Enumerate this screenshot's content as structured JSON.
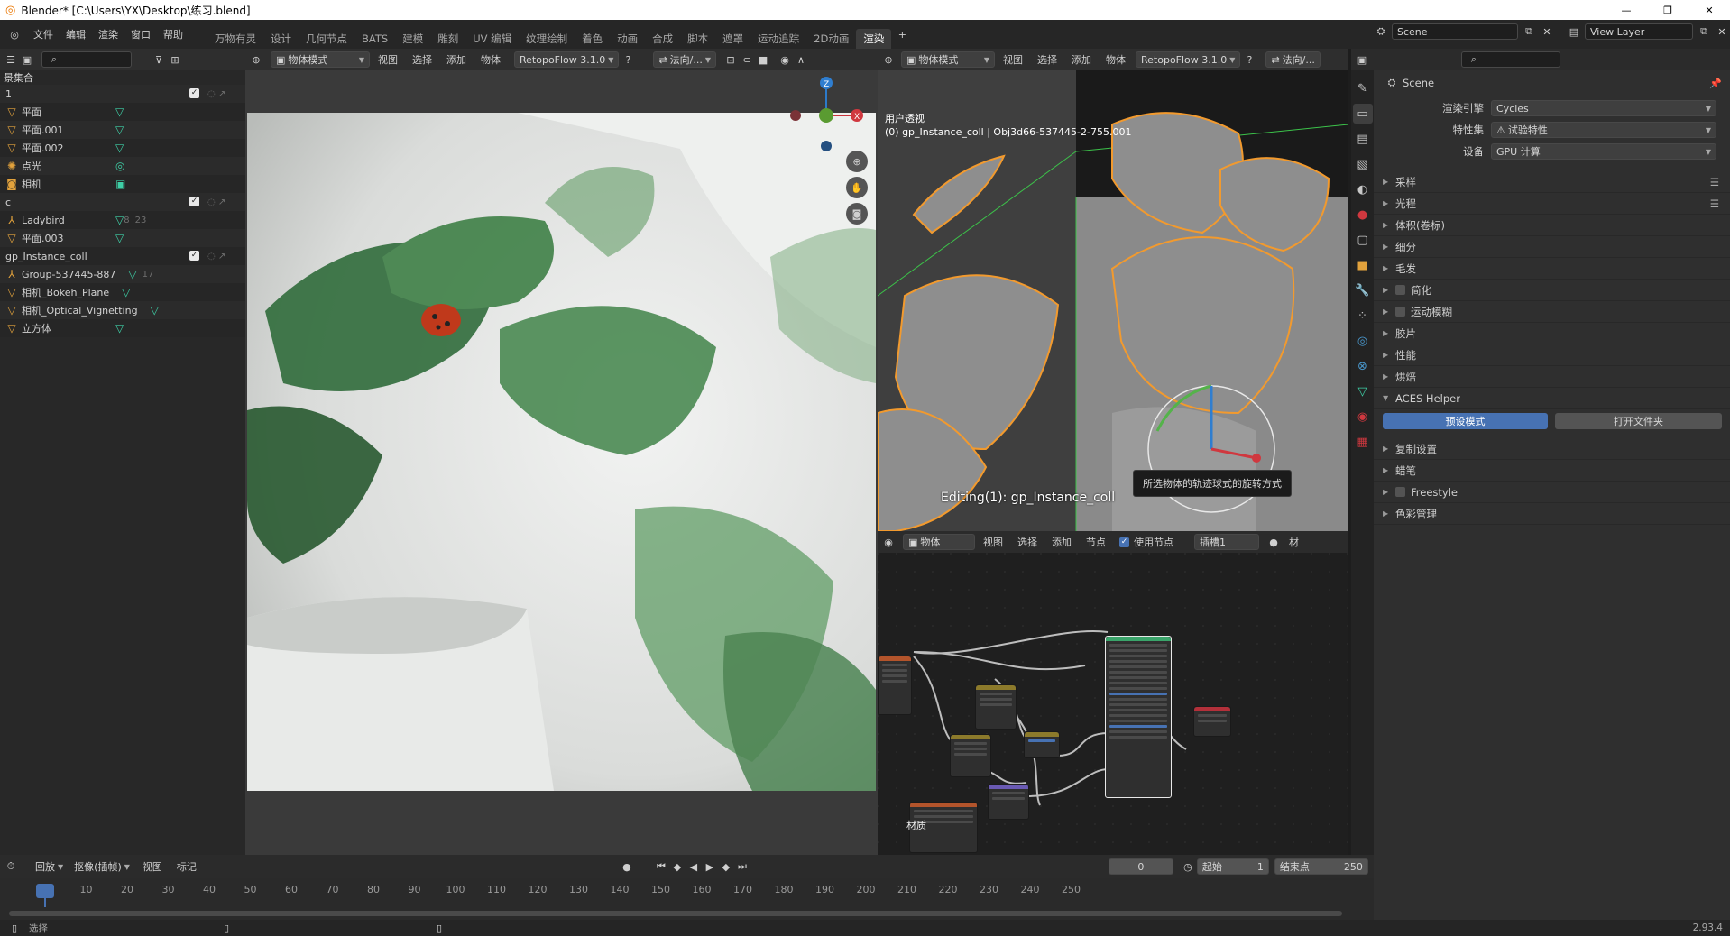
{
  "titlebar": {
    "title": "Blender* [C:\\Users\\YX\\Desktop\\练习.blend]",
    "controls": [
      "—",
      "❐",
      "✕"
    ]
  },
  "menu": {
    "items": [
      "文件",
      "编辑",
      "渲染",
      "窗口",
      "帮助"
    ]
  },
  "workspaces": [
    "万物有灵",
    "设计",
    "几何节点",
    "BATS",
    "建模",
    "雕刻",
    "UV 编辑",
    "纹理绘制",
    "着色",
    "动画",
    "合成",
    "脚本",
    "遮罩",
    "运动追踪",
    "2D动画",
    "渲染"
  ],
  "active_workspace": "渲染",
  "scene": {
    "label": "Scene",
    "view_layer": "View Layer"
  },
  "outliner": {
    "title": "景集合",
    "rows": [
      {
        "name": "1",
        "kind": "collection",
        "checked": true
      },
      {
        "name": "平面",
        "kind": "mesh"
      },
      {
        "name": "平面.001",
        "kind": "mesh"
      },
      {
        "name": "平面.002",
        "kind": "mesh"
      },
      {
        "name": "点光",
        "kind": "light"
      },
      {
        "name": "相机",
        "kind": "camera"
      },
      {
        "name": "c",
        "kind": "collection",
        "checked": true
      },
      {
        "name": "Ladybird",
        "kind": "armature",
        "badge1": "8",
        "badge2": "23"
      },
      {
        "name": "平面.003",
        "kind": "mesh"
      },
      {
        "name": "gp_Instance_coll",
        "kind": "collection",
        "checked": true
      },
      {
        "name": "Group-537445-887",
        "kind": "armature",
        "badge2": "17"
      },
      {
        "name": "相机_Bokeh_Plane",
        "kind": "mesh"
      },
      {
        "name": "相机_Optical_Vignetting",
        "kind": "mesh"
      },
      {
        "name": "立方体",
        "kind": "mesh"
      }
    ]
  },
  "viewport_left": {
    "mode": "物体模式",
    "menus": [
      "视图",
      "选择",
      "添加",
      "物体"
    ],
    "addon": "RetopoFlow 3.1.0",
    "orient": "法向/..."
  },
  "viewport_right": {
    "mode": "物体模式",
    "menus": [
      "视图",
      "选择",
      "添加",
      "物体"
    ],
    "addon": "RetopoFlow 3.1.0",
    "orient": "法向/...",
    "overlay_title": "用户透视",
    "overlay_sub": "(0) gp_Instance_coll | Obj3d66-537445-2-755.001",
    "editing": "Editing(1): gp_Instance_coll",
    "tooltip": "所选物体的轨迹球式的旋转方式"
  },
  "node_editor": {
    "type": "物体",
    "menus": [
      "视图",
      "选择",
      "添加",
      "节点"
    ],
    "use_nodes": "使用节点",
    "slot": "插槽1",
    "material_label": "材质",
    "mat_short": "材"
  },
  "properties": {
    "scene_name": "Scene",
    "render_engine_label": "渲染引擎",
    "render_engine": "Cycles",
    "feature_set_label": "特性集",
    "feature_set": "试验特性",
    "device_label": "设备",
    "device": "GPU 计算",
    "panels": [
      "采样",
      "光程",
      "体积(卷标)",
      "细分",
      "毛发",
      "简化",
      "运动模糊",
      "胶片",
      "性能",
      "烘焙"
    ],
    "aces_panel": "ACES Helper",
    "aces_btn1": "预设模式",
    "aces_btn2": "打开文件夹",
    "panels2": [
      "复制设置",
      "蜡笔",
      "Freestyle",
      "色彩管理"
    ]
  },
  "timeline": {
    "playback": "回放",
    "keying": "抠像(插帧)",
    "view": "视图",
    "marker": "标记",
    "current_frame": "0",
    "start_label": "起始",
    "start": "1",
    "end_label": "结束点",
    "end": "250",
    "ticks": [
      "0",
      "10",
      "20",
      "30",
      "40",
      "50",
      "60",
      "70",
      "80",
      "90",
      "100",
      "110",
      "120",
      "130",
      "140",
      "150",
      "160",
      "170",
      "180",
      "190",
      "200",
      "210",
      "220",
      "230",
      "240",
      "250"
    ]
  },
  "status": {
    "left": "选择",
    "version": "2.93.4"
  },
  "colors": {
    "accent": "#4772b3",
    "active_ws": "#3c3c3c",
    "selection_orange": "#f29a2e"
  }
}
